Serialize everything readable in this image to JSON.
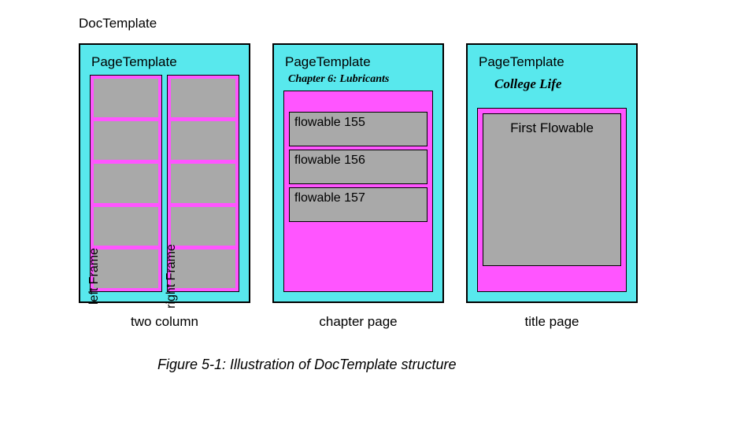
{
  "doc_title": "DocTemplate",
  "templates": {
    "two_column": {
      "header": "PageTemplate",
      "left_label": "left Frame",
      "right_label": "right Frame",
      "caption": "two column"
    },
    "chapter": {
      "header": "PageTemplate",
      "subtitle": "Chapter 6: Lubricants",
      "flowables": [
        "flowable 155",
        "flowable 156",
        "flowable 157"
      ],
      "caption": "chapter page"
    },
    "title": {
      "header": "PageTemplate",
      "subtitle": "College Life",
      "flowable_label": "First Flowable",
      "caption": "title page"
    }
  },
  "figure_caption": "Figure 5-1: Illustration of DocTemplate structure"
}
